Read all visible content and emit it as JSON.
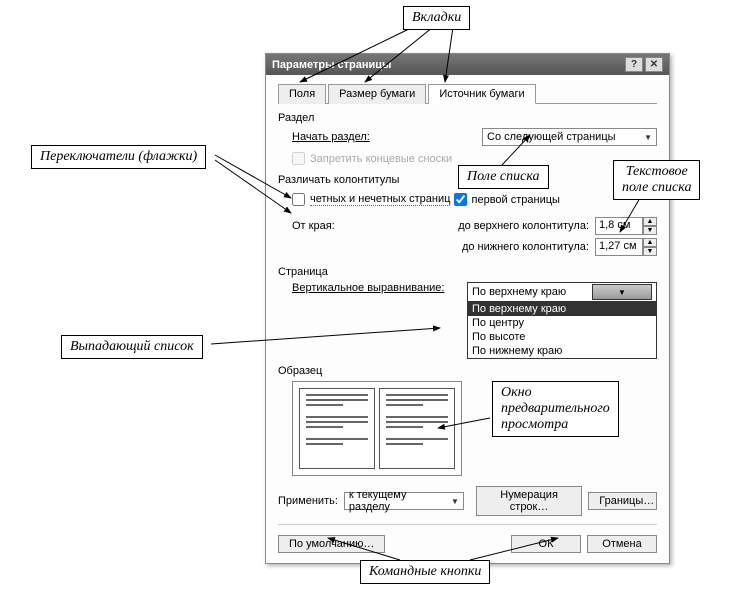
{
  "annotations": {
    "tabs": "Вкладки",
    "switches": "Переключатели (флажки)",
    "listfield": "Поле списка",
    "textlistfield": "Текстовое\nполе списка",
    "dropdown": "Выпадающий список",
    "preview": "Окно\nпредварительного\nпросмотра",
    "cmdbuttons": "Командные кнопки"
  },
  "dialog": {
    "title": "Параметры страницы",
    "tabs": {
      "t1": "Поля",
      "t2": "Размер бумаги",
      "t3": "Источник бумаги"
    },
    "section": "Раздел",
    "start_section": "Начать раздел:",
    "start_section_val": "Со следующей страницы",
    "suppress_endnotes": "Запретить концевые сноски",
    "headers_footers": "Различать колонтитулы",
    "odd_even": "четных и нечетных страниц",
    "first_page": "первой страницы",
    "from_edge": "От края:",
    "to_header": "до верхнего колонтитула:",
    "to_header_val": "1,8 см",
    "to_footer": "до нижнего колонтитула:",
    "to_footer_val": "1,27 см",
    "page": "Страница",
    "valign": "Вертикальное выравнивание:",
    "valign_sel": "По верхнему краю",
    "valign_opts": {
      "o1": "По верхнему краю",
      "o2": "По центру",
      "o3": "По высоте",
      "o4": "По нижнему краю"
    },
    "sample": "Образец",
    "apply_to": "Применить:",
    "apply_to_val": "к текущему разделу",
    "line_numbers": "Нумерация строк…",
    "borders": "Границы…",
    "default": "По умолчанию…",
    "ok": "ОК",
    "cancel": "Отмена"
  }
}
